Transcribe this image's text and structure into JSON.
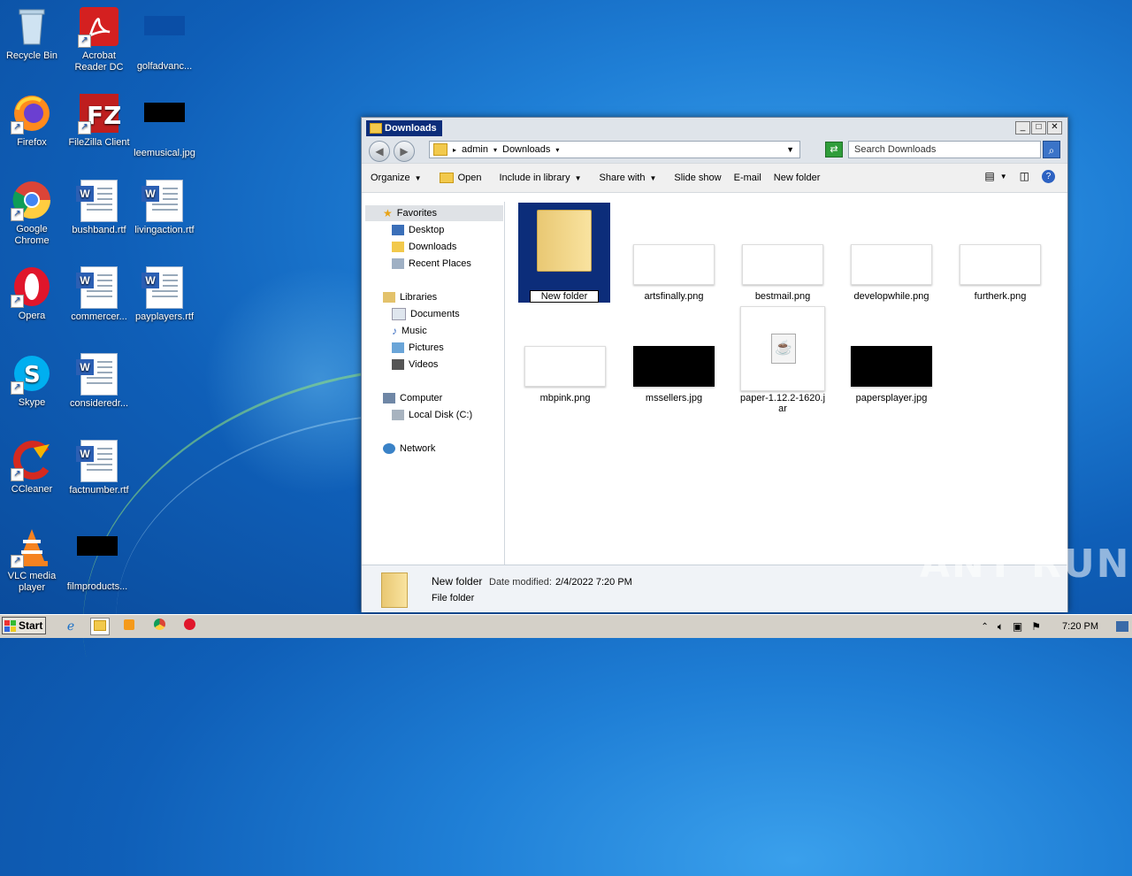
{
  "desktop": {
    "icons": [
      {
        "label": "Recycle Bin"
      },
      {
        "label": "Acrobat Reader DC"
      },
      {
        "label": "golfadvanc..."
      },
      {
        "label": "Firefox"
      },
      {
        "label": "FileZilla Client"
      },
      {
        "label": "leemusical.jpg"
      },
      {
        "label": "Google Chrome"
      },
      {
        "label": "bushband.rtf"
      },
      {
        "label": "livingaction.rtf"
      },
      {
        "label": "Opera"
      },
      {
        "label": "commercer..."
      },
      {
        "label": "payplayers.rtf"
      },
      {
        "label": "Skype"
      },
      {
        "label": "consideredr..."
      },
      {
        "label": "CCleaner"
      },
      {
        "label": "factnumber.rtf"
      },
      {
        "label": "VLC media player"
      },
      {
        "label": "filmproducts..."
      }
    ]
  },
  "explorer": {
    "title": "Downloads",
    "breadcrumb": [
      "admin",
      "Downloads"
    ],
    "search_placeholder": "Search Downloads",
    "toolbar": {
      "organize": "Organize",
      "open": "Open",
      "include": "Include in library",
      "share": "Share with",
      "slideshow": "Slide show",
      "email": "E-mail",
      "newfolder": "New folder"
    },
    "nav": {
      "favorites": "Favorites",
      "desktop": "Desktop",
      "downloads": "Downloads",
      "recent": "Recent Places",
      "libraries": "Libraries",
      "documents": "Documents",
      "music": "Music",
      "pictures": "Pictures",
      "videos": "Videos",
      "computer": "Computer",
      "localdisk": "Local Disk (C:)",
      "network": "Network"
    },
    "files": [
      {
        "name": "New folder"
      },
      {
        "name": "artsfinally.png"
      },
      {
        "name": "bestmail.png"
      },
      {
        "name": "developwhile.png"
      },
      {
        "name": "furtherk.png"
      },
      {
        "name": "mbpink.png"
      },
      {
        "name": "mssellers.jpg"
      },
      {
        "name": "paper-1.12.2-1620.jar"
      },
      {
        "name": "papersplayer.jpg"
      }
    ],
    "details": {
      "name": "New folder",
      "modified_label": "Date modified:",
      "modified_value": "2/4/2022 7:20 PM",
      "type": "File folder"
    }
  },
  "taskbar": {
    "start": "Start",
    "clock": "7:20 PM"
  },
  "watermark": "ANY RUN"
}
